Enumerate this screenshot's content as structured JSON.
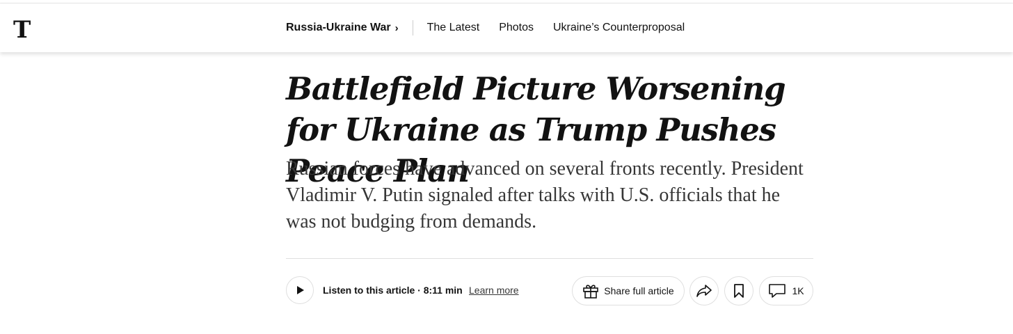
{
  "header": {
    "logo_label": "The New York Times",
    "section": "Russia-Ukraine War",
    "section_chevron": "›",
    "links": [
      "The Latest",
      "Photos",
      "Ukraine’s Counterproposal"
    ]
  },
  "article": {
    "headline": "Battlefield Picture Worsening for Ukraine as Trump Pushes Peace Plan",
    "summary": "Russian forces have advanced on several fronts recently. President Vladimir V. Putin signaled after talks with U.S. officials that he was not budging from demands."
  },
  "toolbar": {
    "listen_label": "Listen to this article · 8:11 min",
    "learn_more": "Learn more",
    "share_full": "Share full article",
    "comments_count": "1K",
    "icons": [
      "play-icon",
      "gift-icon",
      "share-icon",
      "bookmark-icon",
      "comment-icon"
    ]
  }
}
